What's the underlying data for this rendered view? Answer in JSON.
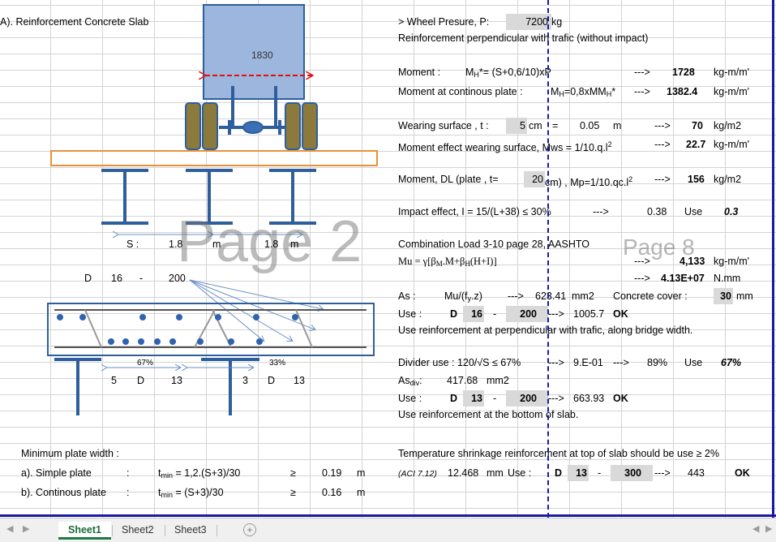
{
  "section_title": "A).  Reinforcement Concrete Slab",
  "diagram": {
    "truck_width": "1830",
    "spacing_label": "S :",
    "spacing_1": "1.8",
    "spacing_1_unit": "m",
    "spacing_2": "1.8",
    "spacing_2_unit": "m",
    "bar_d": "D",
    "bar_size": "16",
    "bar_dash": "-",
    "bar_spacing": "200",
    "pct_left": "67%",
    "pct_right": "33%",
    "left_count": "5",
    "left_d": "D",
    "left_size": "13",
    "right_count": "3",
    "right_d": "D",
    "right_size": "13",
    "watermark_page2": "Page 2"
  },
  "calc": {
    "wheel_label": "> Wheel Presure, P:",
    "wheel_value": "7200",
    "wheel_unit": "kg",
    "perp_heading": "Reinforcement perpendicular with trafic (without impact)",
    "moment_label": "Moment :",
    "moment_formula": "= (S+0,6/10)xP",
    "moment_value": "1728",
    "moment_unit": "kg-m/m'",
    "moment_cont_label": "Moment at continous plate :",
    "moment_cont_formula": "=0,8xM",
    "moment_cont_value": "1382.4",
    "moment_cont_unit": "kg-m/m'",
    "wearing_label": "Wearing surface , t :",
    "wearing_t": "5",
    "wearing_t_unit": "cm",
    "wearing_eq": "=",
    "wearing_m": "0.05",
    "wearing_m_unit": "m",
    "wearing_load": "70",
    "wearing_load_unit": "kg/m2",
    "mws_label": "Moment effect wearing surface, Mws = 1/10.q.l",
    "mws_value": "22.7",
    "mws_unit": "kg-m/m'",
    "dl_label": "Moment, DL (plate , t=",
    "dl_t": "20",
    "dl_formula": "cm) , Mp=1/10.qc.l",
    "dl_value": "156",
    "dl_unit": "kg/m2",
    "impact_label": "Impact effect, I = 15/(L+38) ≤ 30%",
    "impact_value": "0.38",
    "impact_use": "Use",
    "impact_used": "0.3",
    "combo_label": "Combination Load 3-10 page 28, AASHTO",
    "mu_label": "Mu = γ[β",
    "mu_value1": "4,133",
    "mu_unit1": "kg-m/m'",
    "mu_value2": "4.13E+07",
    "mu_unit2": "N.mm",
    "as_label": "As   :",
    "as_formula": "Mu/(f",
    "as_value": "623.41",
    "as_unit": "mm2",
    "cover_label": "Concrete cover :",
    "cover_value": "30",
    "cover_unit": "mm",
    "use1_label": "Use :",
    "use1_d": "D",
    "use1_size": "16",
    "use1_dash": "-",
    "use1_spacing": "200",
    "use1_value": "1005.7",
    "use1_ok": "OK",
    "use1_note": "Use reinforcement at perpendicular with trafic, along bridge width.",
    "divider_label": "Divider use : 120/√S ≤ 67%",
    "divider_value": "9.E-01",
    "divider_pct": "89%",
    "divider_use": "Use",
    "divider_used": "67%",
    "asdiv_label": "As",
    "asdiv_value": "417.68",
    "asdiv_unit": "mm2",
    "use2_label": "Use :",
    "use2_d": "D",
    "use2_size": "13",
    "use2_dash": "-",
    "use2_spacing": "200",
    "use2_value": "663.93",
    "use2_ok": "OK",
    "use2_note": "Use reinforcement at the bottom of slab.",
    "temp_label": "Temperature shrinkage reinforcement at top of slab should be use ≥ 2%",
    "aci_label": "(ACI 7.12)",
    "aci_value": "12.468",
    "aci_unit": "mm",
    "aci_use": "Use :",
    "aci_d": "D",
    "aci_size": "13",
    "aci_dash": "-",
    "aci_spacing": "300",
    "aci_value2": "443",
    "aci_ok": "OK",
    "arrow": "--->",
    "watermark_page8": "Page 8"
  },
  "min_plate": {
    "heading": "Minimum plate width :",
    "simple_label": "a). Simple plate",
    "simple_colon": ":",
    "simple_formula": " = 1,2.(S+3)/30",
    "simple_ge": "≥",
    "simple_value": "0.19",
    "simple_unit": "m",
    "cont_label": "b). Continous plate",
    "cont_colon": ":",
    "cont_formula": " = (S+3)/30",
    "cont_ge": "≥",
    "cont_value": "0.16",
    "cont_unit": "m"
  },
  "tabs": [
    "Sheet1",
    "Sheet2",
    "Sheet3"
  ],
  "colors": {
    "truck_fill": "#9db6dd",
    "wheel_fill": "#8c7a3c",
    "steel_blue": "#2e5f9c",
    "slab_outline": "#e8913a",
    "page_break": "#1a1aa8",
    "sheet_tab_active": "#1d7a43"
  }
}
